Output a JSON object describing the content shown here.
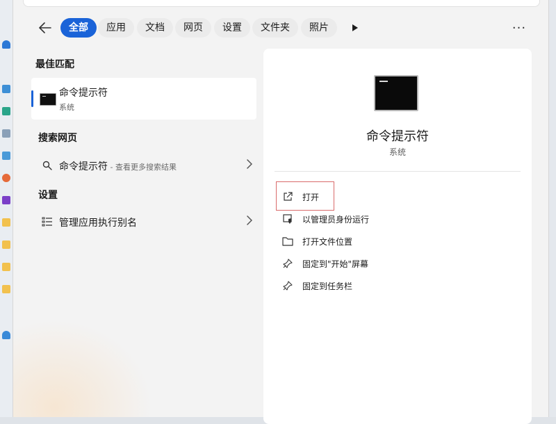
{
  "filters": {
    "chips": [
      {
        "label": "全部",
        "active": true
      },
      {
        "label": "应用",
        "active": false
      },
      {
        "label": "文档",
        "active": false
      },
      {
        "label": "网页",
        "active": false
      },
      {
        "label": "设置",
        "active": false
      },
      {
        "label": "文件夹",
        "active": false
      },
      {
        "label": "照片",
        "active": false
      }
    ]
  },
  "results": {
    "best_match_title": "最佳匹配",
    "best_match": {
      "name": "命令提示符",
      "type": "系统"
    },
    "web_title": "搜索网页",
    "web_item": {
      "query": "命令提示符",
      "hint": " - 查看更多搜索结果"
    },
    "settings_title": "设置",
    "settings_item": {
      "label": "管理应用执行别名"
    }
  },
  "detail": {
    "name": "命令提示符",
    "type": "系统",
    "actions": [
      {
        "label": "打开",
        "icon": "open-external-icon"
      },
      {
        "label": "以管理员身份运行",
        "icon": "shield-icon"
      },
      {
        "label": "打开文件位置",
        "icon": "folder-icon"
      },
      {
        "label": "固定到\"开始\"屏幕",
        "icon": "pin-icon"
      },
      {
        "label": "固定到任务栏",
        "icon": "pin-icon"
      }
    ]
  },
  "colors": {
    "accent": "#1a63d8",
    "highlight_box": "#d96a6a"
  }
}
